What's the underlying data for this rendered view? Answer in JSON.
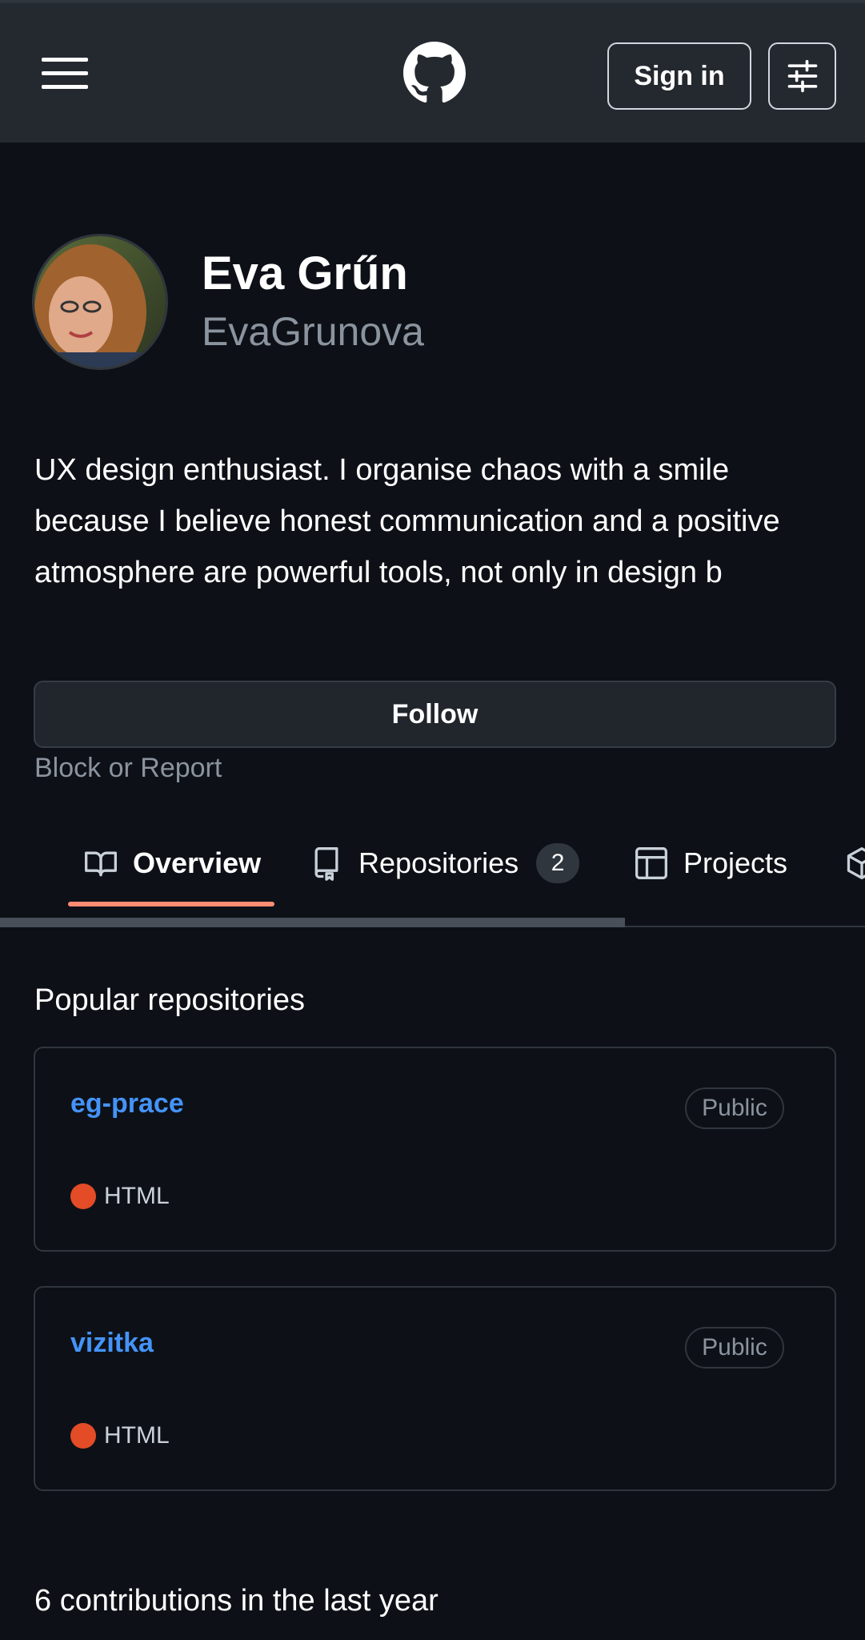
{
  "header": {
    "menu_icon": "hamburger-menu-icon",
    "logo_icon": "github-mark-icon",
    "sign_in_label": "Sign in",
    "settings_icon": "sliders-icon"
  },
  "profile": {
    "name": "Eva Grűn",
    "username": "EvaGrunova",
    "bio": "UX design enthusiast. I organise chaos with a smile because I believe honest communication and a positive atmosphere are powerful tools, not only in design b",
    "follow_label": "Follow",
    "block_label": "Block or Report"
  },
  "tabs": [
    {
      "label": "Overview",
      "icon": "book-icon",
      "active": true
    },
    {
      "label": "Repositories",
      "icon": "repo-icon",
      "count": "2"
    },
    {
      "label": "Projects",
      "icon": "table-icon"
    },
    {
      "label": "",
      "icon": "package-icon"
    }
  ],
  "popular": {
    "title": "Popular repositories",
    "repos": [
      {
        "name": "eg-prace",
        "visibility": "Public",
        "language": "HTML",
        "lang_color": "#e34c26"
      },
      {
        "name": "vizitka",
        "visibility": "Public",
        "language": "HTML",
        "lang_color": "#e34c26"
      }
    ]
  },
  "contributions": "6 contributions in the last year",
  "colors": {
    "background": "#0d1117",
    "header": "#24292f",
    "link": "#4493f8",
    "active_tab_underline": "#fd8c73"
  }
}
